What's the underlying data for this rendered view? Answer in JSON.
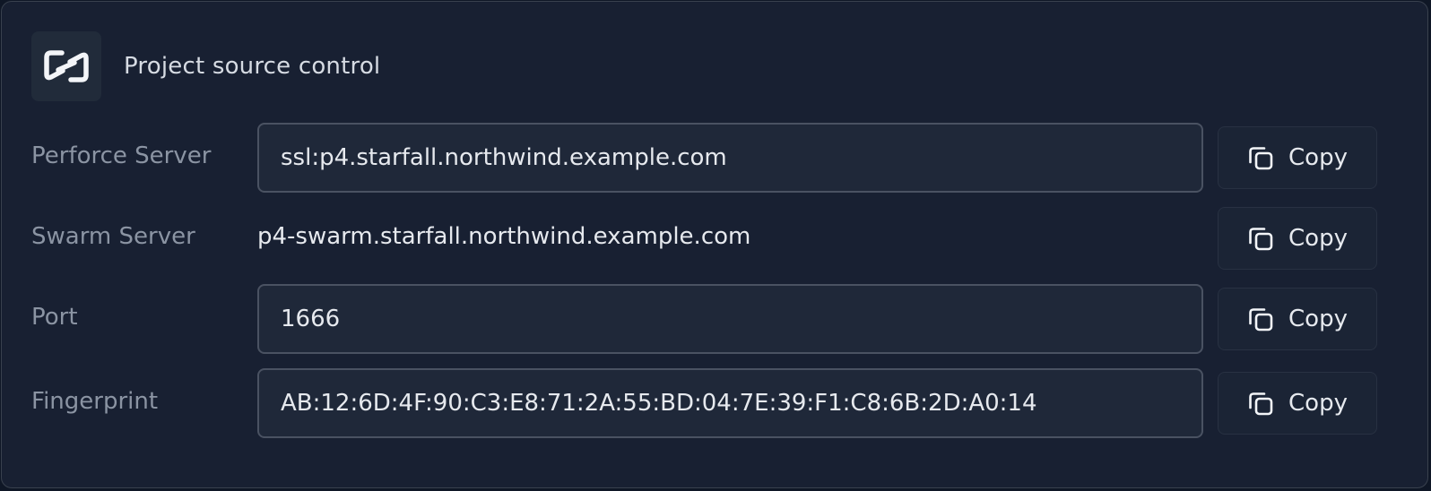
{
  "header": {
    "title": "Project source control",
    "logo_icon": "chain-link-logo-icon"
  },
  "rows": [
    {
      "label": "Perforce Server",
      "value": "ssl:p4.starfall.northwind.example.com",
      "style": "field",
      "copy_label": "Copy",
      "copy_icon": "copy-icon"
    },
    {
      "label": "Swarm Server",
      "value": "p4-swarm.starfall.northwind.example.com",
      "style": "plain",
      "copy_label": "Copy",
      "copy_icon": "copy-icon"
    },
    {
      "label": "Port",
      "value": "1666",
      "style": "field",
      "copy_label": "Copy",
      "copy_icon": "copy-icon"
    },
    {
      "label": "Fingerprint",
      "value": "AB:12:6D:4F:90:C3:E8:71:2A:55:BD:04:7E:39:F1:C8:6B:2D:A0:14",
      "style": "field",
      "copy_label": "Copy",
      "copy_icon": "copy-icon"
    }
  ],
  "colors": {
    "background": "#182032",
    "field_background": "#1f2839",
    "field_border": "#4a5262",
    "label_text": "#8b94a3",
    "value_text": "#e6e9ee"
  }
}
